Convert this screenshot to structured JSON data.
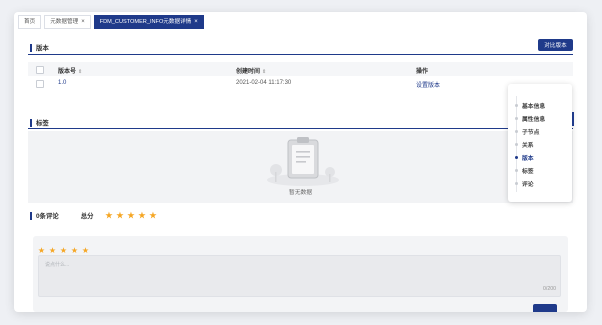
{
  "tabs": [
    {
      "label": "首页"
    },
    {
      "label": "元数据管理",
      "close": "×"
    },
    {
      "label": "FDM_CUSTOMER_INFO元数据详情",
      "close": "×"
    }
  ],
  "version_section": {
    "title": "版本",
    "compare_button": "对比版本",
    "columns": [
      "版本号",
      "创建时间",
      "操作"
    ],
    "sort_icon": "⇕",
    "rows": [
      {
        "version": "1.0",
        "created": "2021-02-04 11:17:30",
        "action": "设置版本"
      }
    ]
  },
  "tags_section": {
    "title": "标签",
    "empty_text": "暂无数据"
  },
  "comments_section": {
    "title": "0条评论",
    "total_label": "总分",
    "star": "★",
    "placeholder": "说点什么...",
    "counter": "0/200"
  },
  "anchor_nav": {
    "items": [
      "基本信息",
      "属性信息",
      "子节点",
      "关系",
      "版本",
      "标签",
      "评论"
    ],
    "active": "版本"
  },
  "colors": {
    "primary": "#1f3a8a",
    "star": "#f5a623"
  }
}
